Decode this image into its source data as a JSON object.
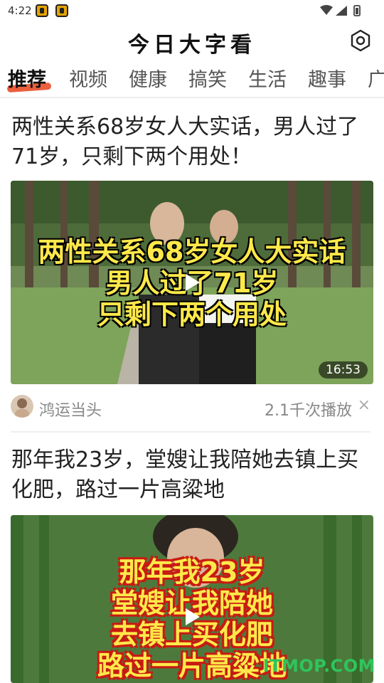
{
  "status_bar": {
    "time": "4:22"
  },
  "header": {
    "app_title": "今日大字看",
    "settings_icon": "hexagon-settings-icon"
  },
  "tabs": [
    {
      "label": "推荐",
      "active": true
    },
    {
      "label": "视频"
    },
    {
      "label": "健康"
    },
    {
      "label": "搞笑"
    },
    {
      "label": "生活"
    },
    {
      "label": "趣事"
    },
    {
      "label": "广"
    }
  ],
  "feed": [
    {
      "title": "两性关系68岁女人大实话，男人过了71岁，只剩下两个用处！",
      "thumbnail_lines": [
        "两性关系68岁女人大实话",
        "男人过了71岁",
        "只剩下两个用处"
      ],
      "duration": "16:53",
      "author": "鸿运当头",
      "plays": "2.1千次播放",
      "dismiss": "×"
    },
    {
      "title": "那年我23岁，堂嫂让我陪她去镇上买化肥，路过一片高粱地",
      "thumbnail_lines": [
        "那年我23岁",
        "堂嫂让我陪她",
        "去镇上买化肥",
        "路过一片高粱地"
      ]
    }
  ],
  "watermark": "ITMOP.COM",
  "colors": {
    "accent": "#e8431c",
    "overlay_text": "#ffe94a",
    "watermark": "#2fc45c"
  }
}
